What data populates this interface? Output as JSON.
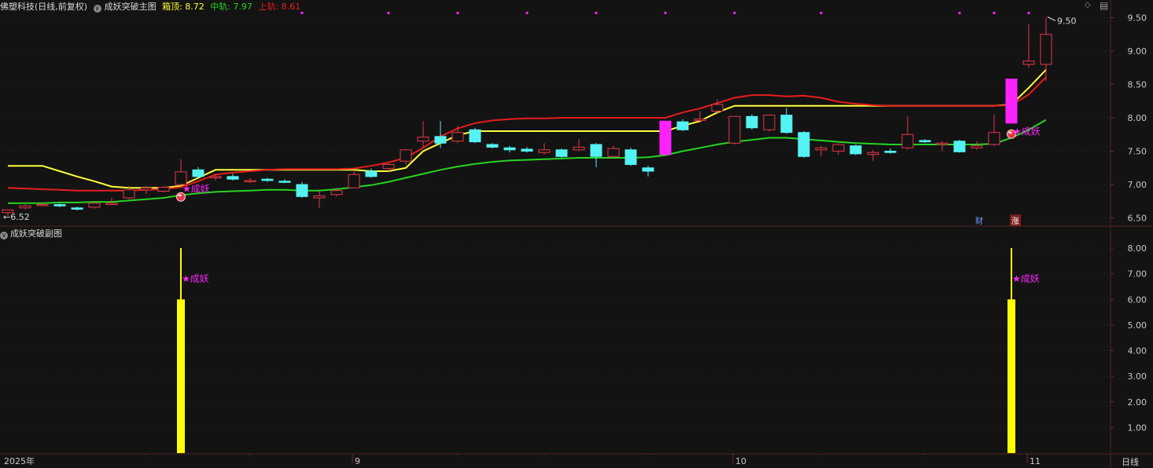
{
  "header": {
    "stock_name": "佛塑科技",
    "period_label": "(日线,前复权)",
    "indicator_name": "成妖突破主图",
    "top_label": "箱顶: 8.72",
    "mid_label": "中轨: 7.97",
    "upper_label": "上轨: 8.61"
  },
  "sub_header": {
    "indicator_name": "成妖突破副图"
  },
  "axis": {
    "year_label": "2025年",
    "month_labels": [
      "9",
      "10",
      "11"
    ],
    "period_button": "日线"
  },
  "markers": {
    "high_price": "9.50",
    "low_price": "6.52",
    "signal_text": "★成妖",
    "finance_badge": "财",
    "rise_badge": "涨"
  },
  "colors": {
    "background": "#131313",
    "up_candle": "#e8374a",
    "down_candle": "#54f2f2",
    "signal_candle": "#ff22ff",
    "yellow_line": "#ffff3a",
    "red_line": "#e81c1c",
    "green_line": "#27d320",
    "signal_text": "#ff22ff",
    "bar": "#ffff00"
  },
  "chart_data": [
    {
      "type": "candlestick",
      "title": "成妖突破主图",
      "ylim": [
        6.4,
        9.6
      ],
      "y_ticks": [
        "6.50",
        "7.00",
        "7.50",
        "8.00",
        "8.50",
        "9.00",
        "9.50"
      ],
      "candles": [
        {
          "o": 6.58,
          "h": 6.63,
          "l": 6.53,
          "c": 6.62
        },
        {
          "o": 6.65,
          "h": 6.7,
          "l": 6.63,
          "c": 6.68
        },
        {
          "o": 6.7,
          "h": 6.72,
          "l": 6.67,
          "c": 6.7
        },
        {
          "o": 6.7,
          "h": 6.72,
          "l": 6.66,
          "c": 6.68
        },
        {
          "o": 6.65,
          "h": 6.67,
          "l": 6.61,
          "c": 6.63
        },
        {
          "o": 6.66,
          "h": 6.72,
          "l": 6.64,
          "c": 6.72
        },
        {
          "o": 6.7,
          "h": 6.8,
          "l": 6.7,
          "c": 6.72
        },
        {
          "o": 6.8,
          "h": 6.98,
          "l": 6.78,
          "c": 6.92
        },
        {
          "o": 6.92,
          "h": 6.98,
          "l": 6.86,
          "c": 6.95
        },
        {
          "o": 6.9,
          "h": 6.98,
          "l": 6.88,
          "c": 6.96
        },
        {
          "o": 7.0,
          "h": 7.38,
          "l": 6.98,
          "c": 7.19
        },
        {
          "o": 7.22,
          "h": 7.26,
          "l": 7.1,
          "c": 7.12
        },
        {
          "o": 7.1,
          "h": 7.16,
          "l": 7.06,
          "c": 7.12
        },
        {
          "o": 7.12,
          "h": 7.16,
          "l": 7.06,
          "c": 7.08
        },
        {
          "o": 7.05,
          "h": 7.1,
          "l": 7.02,
          "c": 7.06
        },
        {
          "o": 7.08,
          "h": 7.1,
          "l": 7.04,
          "c": 7.06
        },
        {
          "o": 7.05,
          "h": 7.08,
          "l": 7.02,
          "c": 7.04
        },
        {
          "o": 7.0,
          "h": 7.04,
          "l": 6.8,
          "c": 6.82
        },
        {
          "o": 6.8,
          "h": 6.9,
          "l": 6.65,
          "c": 6.83
        },
        {
          "o": 6.85,
          "h": 6.95,
          "l": 6.82,
          "c": 6.91
        },
        {
          "o": 6.95,
          "h": 7.2,
          "l": 6.95,
          "c": 7.15
        },
        {
          "o": 7.2,
          "h": 7.24,
          "l": 7.1,
          "c": 7.12
        },
        {
          "o": 7.24,
          "h": 7.32,
          "l": 7.18,
          "c": 7.3
        },
        {
          "o": 7.35,
          "h": 7.52,
          "l": 7.3,
          "c": 7.52
        },
        {
          "o": 7.65,
          "h": 7.95,
          "l": 7.55,
          "c": 7.71
        },
        {
          "o": 7.72,
          "h": 7.95,
          "l": 7.55,
          "c": 7.62
        },
        {
          "o": 7.65,
          "h": 7.88,
          "l": 7.62,
          "c": 7.78
        },
        {
          "o": 7.82,
          "h": 7.85,
          "l": 7.62,
          "c": 7.64
        },
        {
          "o": 7.6,
          "h": 7.62,
          "l": 7.54,
          "c": 7.56
        },
        {
          "o": 7.55,
          "h": 7.58,
          "l": 7.48,
          "c": 7.52
        },
        {
          "o": 7.53,
          "h": 7.56,
          "l": 7.48,
          "c": 7.5
        },
        {
          "o": 7.48,
          "h": 7.62,
          "l": 7.45,
          "c": 7.52
        },
        {
          "o": 7.52,
          "h": 7.54,
          "l": 7.4,
          "c": 7.42
        },
        {
          "o": 7.52,
          "h": 7.68,
          "l": 7.5,
          "c": 7.56
        },
        {
          "o": 7.6,
          "h": 7.62,
          "l": 7.26,
          "c": 7.42
        },
        {
          "o": 7.42,
          "h": 7.58,
          "l": 7.4,
          "c": 7.54
        },
        {
          "o": 7.52,
          "h": 7.55,
          "l": 7.28,
          "c": 7.3
        },
        {
          "o": 7.25,
          "h": 7.28,
          "l": 7.12,
          "c": 7.2
        },
        {
          "o": 7.45,
          "h": 7.95,
          "l": 7.44,
          "c": 7.95,
          "signal": true
        },
        {
          "o": 7.94,
          "h": 7.98,
          "l": 7.8,
          "c": 7.82
        },
        {
          "o": 7.96,
          "h": 8.1,
          "l": 7.92,
          "c": 7.98
        },
        {
          "o": 8.1,
          "h": 8.28,
          "l": 8.05,
          "c": 8.2
        },
        {
          "o": 7.62,
          "h": 8.02,
          "l": 7.6,
          "c": 8.02
        },
        {
          "o": 8.02,
          "h": 8.05,
          "l": 7.82,
          "c": 7.85
        },
        {
          "o": 7.82,
          "h": 8.05,
          "l": 7.8,
          "c": 8.04
        },
        {
          "o": 8.04,
          "h": 8.15,
          "l": 7.76,
          "c": 7.78
        },
        {
          "o": 7.78,
          "h": 7.8,
          "l": 7.4,
          "c": 7.42
        },
        {
          "o": 7.52,
          "h": 7.58,
          "l": 7.42,
          "c": 7.55
        },
        {
          "o": 7.5,
          "h": 7.62,
          "l": 7.45,
          "c": 7.6
        },
        {
          "o": 7.58,
          "h": 7.6,
          "l": 7.44,
          "c": 7.46
        },
        {
          "o": 7.45,
          "h": 7.52,
          "l": 7.35,
          "c": 7.48
        },
        {
          "o": 7.5,
          "h": 7.54,
          "l": 7.46,
          "c": 7.48
        },
        {
          "o": 7.55,
          "h": 8.02,
          "l": 7.52,
          "c": 7.75
        },
        {
          "o": 7.66,
          "h": 7.68,
          "l": 7.62,
          "c": 7.64
        },
        {
          "o": 7.6,
          "h": 7.65,
          "l": 7.5,
          "c": 7.62
        },
        {
          "o": 7.65,
          "h": 7.67,
          "l": 7.48,
          "c": 7.49
        },
        {
          "o": 7.55,
          "h": 7.65,
          "l": 7.52,
          "c": 7.58
        },
        {
          "o": 7.6,
          "h": 8.05,
          "l": 7.58,
          "c": 7.78
        },
        {
          "o": 7.92,
          "h": 8.58,
          "l": 7.92,
          "c": 8.58,
          "signal": true
        },
        {
          "o": 8.8,
          "h": 9.4,
          "l": 8.75,
          "c": 8.85
        },
        {
          "o": 8.8,
          "h": 9.5,
          "l": 8.55,
          "c": 9.25
        }
      ],
      "series": [
        {
          "name": "箱顶",
          "values": [
            7.28,
            7.28,
            7.28,
            7.2,
            7.12,
            7.05,
            6.97,
            6.95,
            6.95,
            6.95,
            6.98,
            7.1,
            7.22,
            7.22,
            7.22,
            7.22,
            7.22,
            7.22,
            7.22,
            7.22,
            7.22,
            7.2,
            7.2,
            7.25,
            7.5,
            7.62,
            7.74,
            7.8,
            7.8,
            7.8,
            7.8,
            7.8,
            7.8,
            7.8,
            7.8,
            7.8,
            7.8,
            7.8,
            7.8,
            7.88,
            7.95,
            8.08,
            8.18,
            8.18,
            8.18,
            8.18,
            8.18,
            8.18,
            8.18,
            8.18,
            8.18,
            8.18,
            8.18,
            8.18,
            8.18,
            8.18,
            8.18,
            8.18,
            8.2,
            8.45,
            8.72
          ]
        },
        {
          "name": "上轨",
          "values": [
            6.95,
            6.94,
            6.93,
            6.92,
            6.91,
            6.91,
            6.91,
            6.91,
            6.92,
            6.93,
            6.96,
            7.05,
            7.15,
            7.18,
            7.2,
            7.22,
            7.23,
            7.23,
            7.23,
            7.23,
            7.24,
            7.28,
            7.33,
            7.4,
            7.55,
            7.72,
            7.84,
            7.92,
            7.96,
            7.98,
            7.99,
            7.99,
            8.0,
            8.0,
            8.0,
            8.0,
            8.0,
            8.0,
            8.0,
            8.08,
            8.14,
            8.22,
            8.3,
            8.34,
            8.34,
            8.32,
            8.33,
            8.3,
            8.24,
            8.21,
            8.19,
            8.18,
            8.18,
            8.18,
            8.18,
            8.18,
            8.18,
            8.18,
            8.19,
            8.35,
            8.61
          ]
        },
        {
          "name": "中轨",
          "values": [
            6.72,
            6.72,
            6.72,
            6.73,
            6.73,
            6.74,
            6.74,
            6.76,
            6.78,
            6.8,
            6.84,
            6.87,
            6.89,
            6.9,
            6.91,
            6.92,
            6.92,
            6.91,
            6.91,
            6.93,
            6.96,
            6.99,
            7.04,
            7.1,
            7.16,
            7.22,
            7.27,
            7.31,
            7.34,
            7.36,
            7.37,
            7.38,
            7.39,
            7.4,
            7.4,
            7.4,
            7.4,
            7.41,
            7.44,
            7.5,
            7.55,
            7.6,
            7.64,
            7.67,
            7.7,
            7.7,
            7.68,
            7.66,
            7.64,
            7.62,
            7.61,
            7.6,
            7.6,
            7.6,
            7.6,
            7.6,
            7.6,
            7.61,
            7.7,
            7.82,
            7.97
          ]
        }
      ],
      "signals": [
        {
          "index": 10,
          "label": "★成妖"
        },
        {
          "index": 58,
          "label": "★成妖"
        }
      ],
      "dots_top_indices": [
        17,
        22,
        26,
        30,
        34,
        38,
        42,
        47,
        55,
        57,
        59
      ],
      "x_month_ticks": [
        {
          "index": 0,
          "label": "2025年"
        },
        {
          "index": 20,
          "label": "9"
        },
        {
          "index": 42,
          "label": "10"
        },
        {
          "index": 59,
          "label": "11"
        }
      ]
    },
    {
      "type": "bar",
      "title": "成妖突破副图",
      "ylim": [
        0,
        8.4
      ],
      "y_ticks": [
        "1.00",
        "2.00",
        "3.00",
        "4.00",
        "5.00",
        "6.00",
        "7.00",
        "8.00"
      ],
      "bars": [
        {
          "index": 10,
          "value": 6,
          "line": 8,
          "label": "★成妖"
        },
        {
          "index": 58,
          "value": 6,
          "line": 8,
          "label": "★成妖"
        }
      ]
    }
  ]
}
